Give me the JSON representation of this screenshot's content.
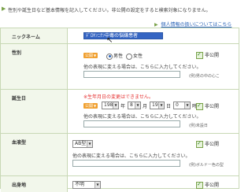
{
  "notice": "性別や誕生日など基本情報を記入してください。非公開の設定をすると検索対象になりません。",
  "privacy_link": "個人情報の扱いについてはこちら",
  "rows": {
    "nickname": {
      "label": "ニックネーム",
      "value": "ﾃﾞﾛｷﾝﾆｸﾝ中毒の悩嫌患者"
    },
    "gender": {
      "label": "性別",
      "badge": "公開",
      "option_male": "男性",
      "option_female": "女性",
      "private_label": "非公開",
      "other_hint": "他の表現に変える場合は、こちらに入力してください。",
      "example": "(例)男の中の心こ"
    },
    "birthday": {
      "label": "誕生日",
      "warning": "※生年月日の変更はできません。",
      "badge": "公開",
      "year": "1980",
      "year_unit": "年",
      "month": "8",
      "month_unit": "月",
      "day": "19",
      "day_unit": "日",
      "hour": "0",
      "hour_unit": "時",
      "private_label": "非公開",
      "other_hint": "他の表現に変える場合は、こちらに入力してください。",
      "example": "(例)未設日"
    },
    "blood": {
      "label": "血液型",
      "select": "AB型",
      "private_label": "非公開",
      "other_hint": "他の表現に変える場合は、こちらに入力してください。",
      "example": "(例)ボルドー色の型"
    },
    "birthplace": {
      "label": "出身地",
      "select": "不明",
      "private_label": "非公開"
    }
  },
  "colors": {
    "accent": "#7aa24a",
    "label_bg": "#f2f7eb",
    "badge": "#f0a030",
    "warning": "#e53030",
    "selection": "#3565c3"
  }
}
